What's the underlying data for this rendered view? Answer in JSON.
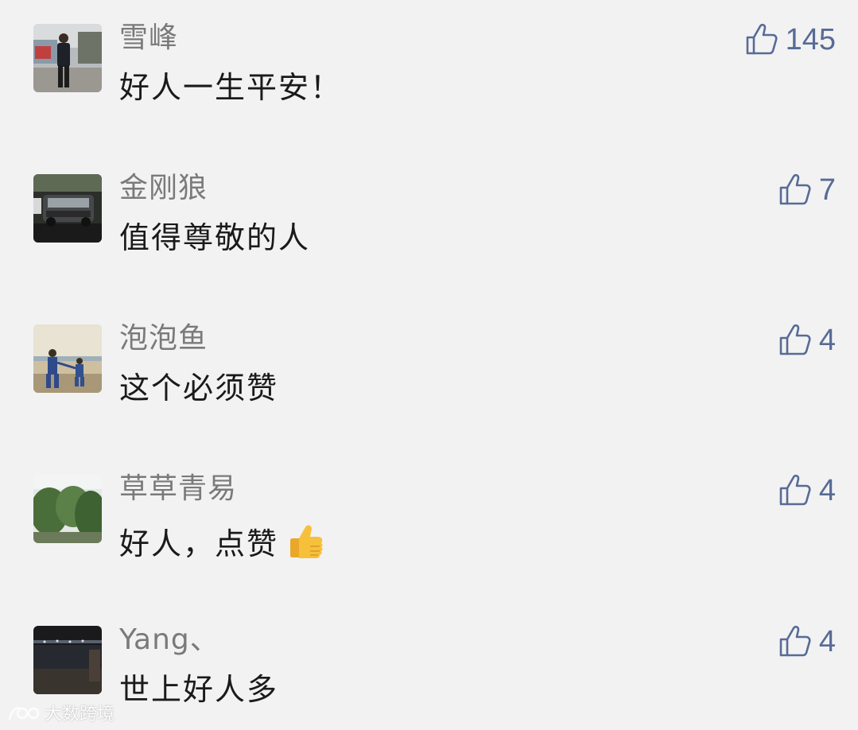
{
  "comments": [
    {
      "avatar": "person-standing-photo",
      "username": "雪峰",
      "text": "好人一生平安！",
      "likes": "145",
      "has_emoji": false
    },
    {
      "avatar": "car-photo",
      "username": "金刚狼",
      "text": "值得尊敬的人",
      "likes": "7",
      "has_emoji": false
    },
    {
      "avatar": "children-beach-photo",
      "username": "泡泡鱼",
      "text": "这个必须赞",
      "likes": "4",
      "has_emoji": false
    },
    {
      "avatar": "trees-photo",
      "username": "草草青易",
      "text": "好人，点赞",
      "likes": "4",
      "has_emoji": true,
      "emoji": "thumbs-up-emoji"
    },
    {
      "avatar": "night-scene-photo",
      "username": "Yang、",
      "text": "世上好人多",
      "likes": "4",
      "has_emoji": false
    }
  ],
  "like_color": "#576b95",
  "watermark": {
    "text": "大数跨境",
    "icon": "logo-icon"
  }
}
